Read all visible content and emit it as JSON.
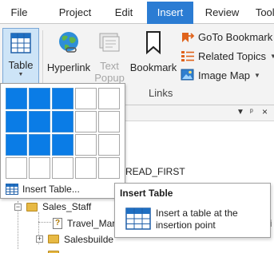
{
  "tabs": [
    {
      "label": "File",
      "active": false
    },
    {
      "label": "Project",
      "active": false
    },
    {
      "label": "Edit",
      "active": false
    },
    {
      "label": "Insert",
      "active": true
    },
    {
      "label": "Review",
      "active": false
    },
    {
      "label": "Tools",
      "active": false
    }
  ],
  "ribbon": {
    "table_label": "Table",
    "hyperlink_label": "Hyperlink",
    "text_popup_line1": "Text",
    "text_popup_line2": "Popup",
    "bookmark_label": "Bookmark",
    "goto_bookmark_label": "GoTo Bookmark",
    "related_topics_label": "Related Topics",
    "image_map_label": "Image Map",
    "links_group_label": "Links"
  },
  "table_dropdown": {
    "rows": 4,
    "cols": 5,
    "selected_rows": 3,
    "selected_cols": 3,
    "insert_table_label": "Insert Table..."
  },
  "tree": {
    "partial_text": "READ_FIRST",
    "sales_staff_label": "Sales_Staff",
    "travel_label": "Travel_Mar",
    "salesbuilder_label": "Salesbuilde",
    "travel_tail": "ei"
  },
  "tooltip": {
    "title": "Insert Table",
    "description": "Insert a table at the insertion point"
  },
  "colors": {
    "accent": "#2b7cd3",
    "grid_selected": "#0a7ce6"
  }
}
